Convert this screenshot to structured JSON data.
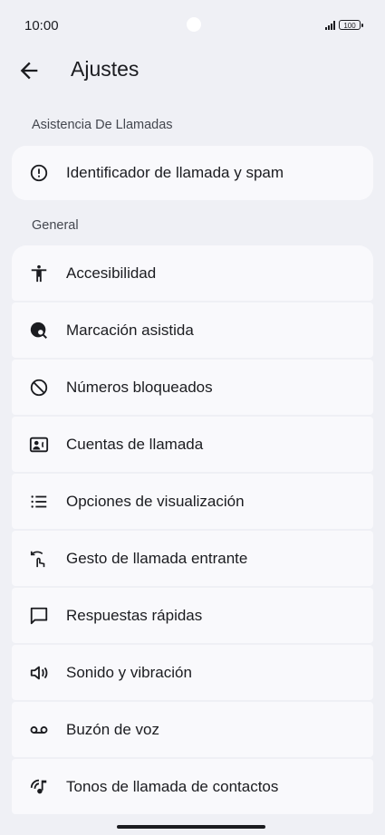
{
  "status": {
    "time": "10:00",
    "battery": "100"
  },
  "header": {
    "title": "Ajustes"
  },
  "sections": {
    "assist_label": "Asistencia De Llamadas",
    "general_label": "General"
  },
  "assist_items": [
    {
      "label": "Identificador de llamada y spam",
      "icon": "alert-circle-icon"
    }
  ],
  "general_items": [
    {
      "label": "Accesibilidad",
      "icon": "accessibility-icon"
    },
    {
      "label": "Marcación asistida",
      "icon": "globe-search-icon"
    },
    {
      "label": "Números bloqueados",
      "icon": "block-icon"
    },
    {
      "label": "Cuentas de llamada",
      "icon": "contact-card-icon"
    },
    {
      "label": "Opciones de visualización",
      "icon": "list-icon"
    },
    {
      "label": "Gesto de llamada entrante",
      "icon": "swipe-gesture-icon"
    },
    {
      "label": "Respuestas rápidas",
      "icon": "chat-bubble-icon"
    },
    {
      "label": "Sonido y vibración",
      "icon": "volume-icon"
    },
    {
      "label": "Buzón de voz",
      "icon": "voicemail-icon"
    },
    {
      "label": "Tonos de llamada de contactos",
      "icon": "ringtone-icon"
    }
  ]
}
